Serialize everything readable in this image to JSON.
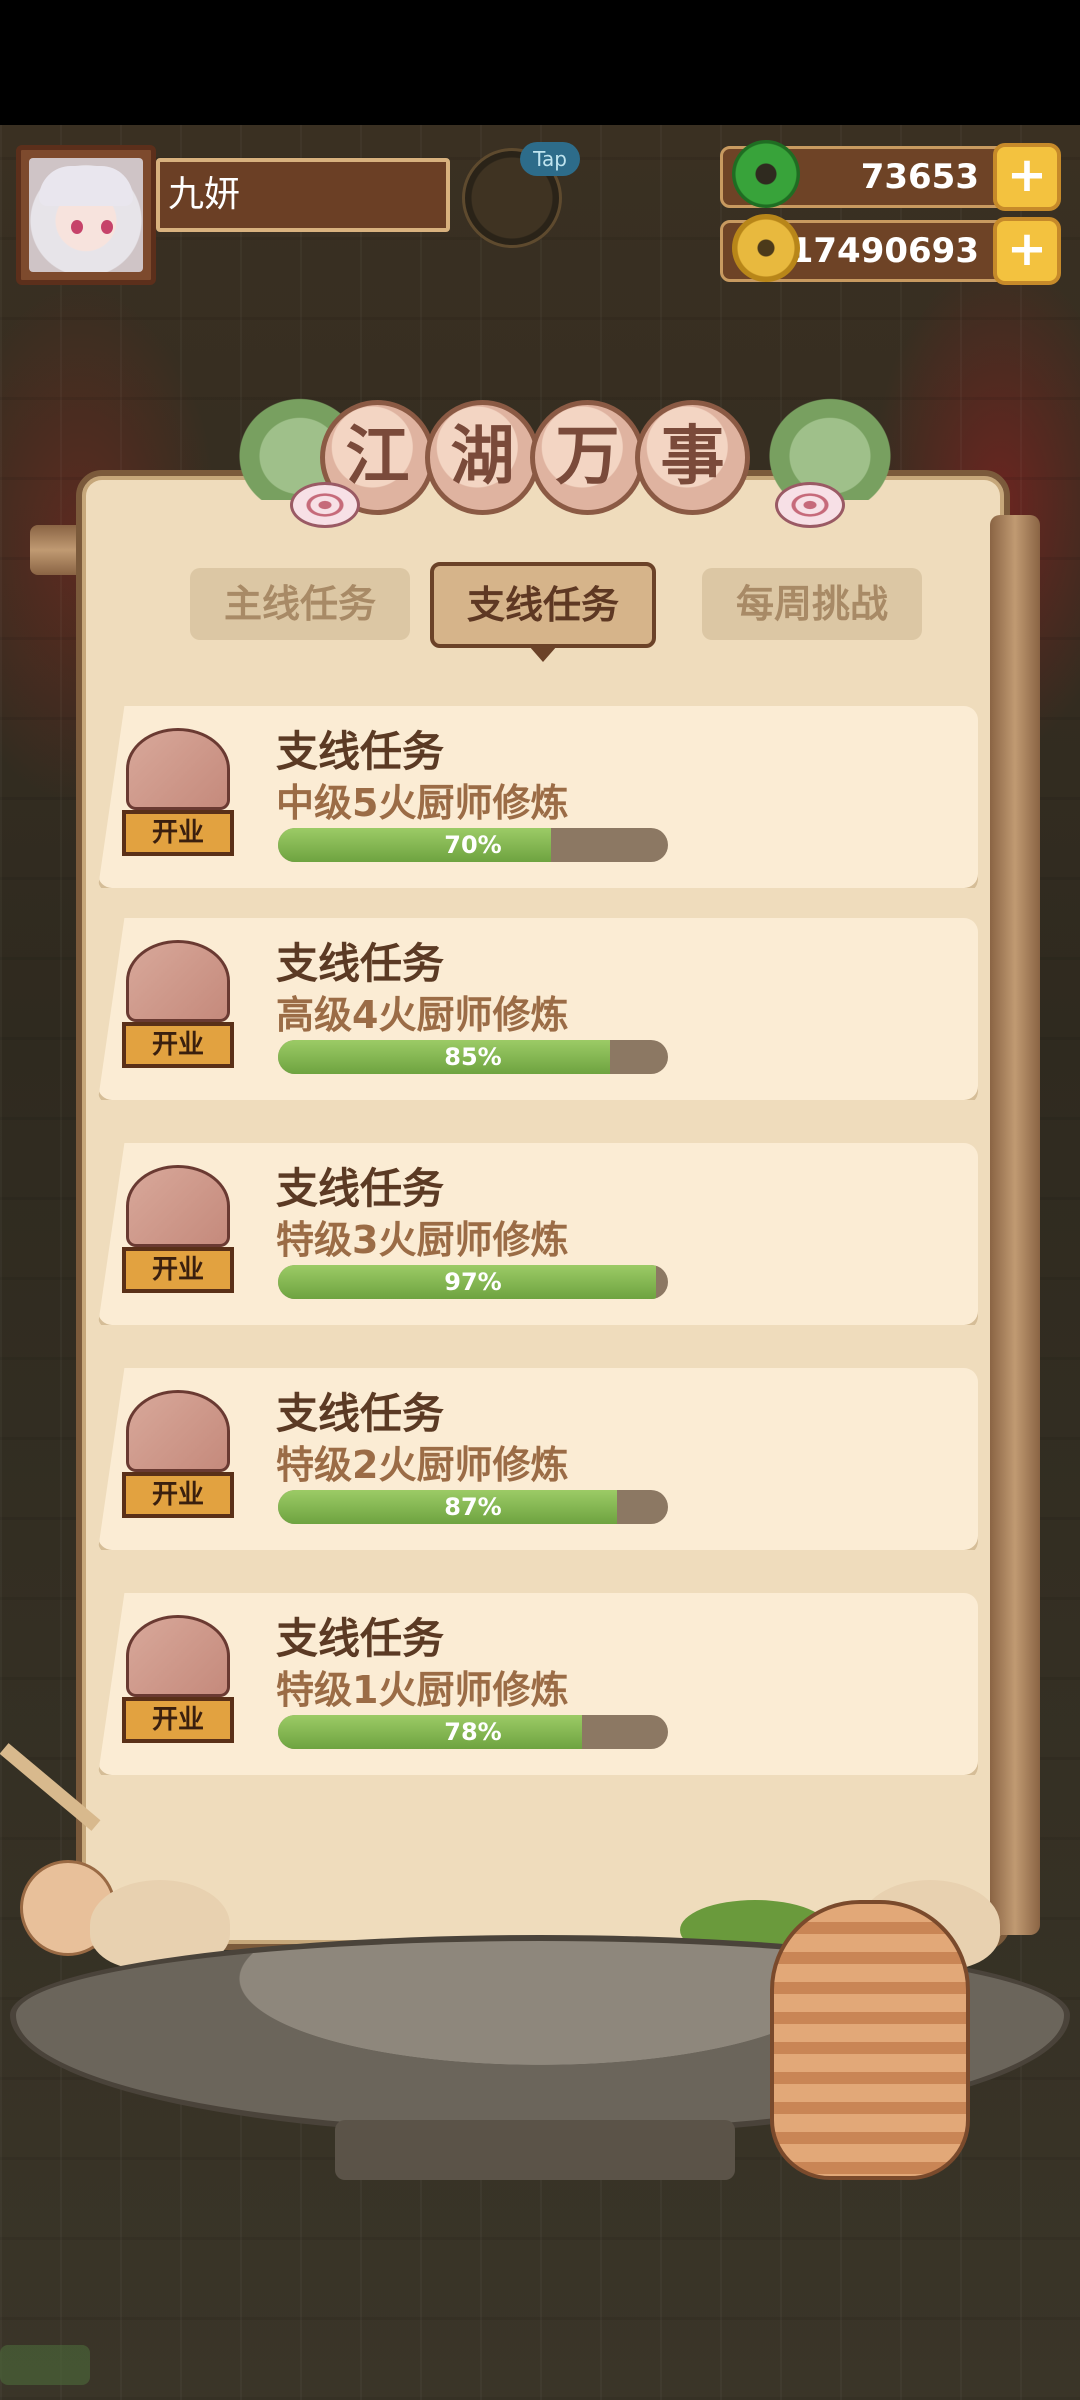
{
  "player": {
    "name": "九妍"
  },
  "tap_label": "Tap",
  "currencies": {
    "jade": {
      "icon": "jade-icon",
      "value": "73653"
    },
    "coin": {
      "icon": "coin-icon",
      "value": "17490693"
    },
    "plus_label": "+"
  },
  "panel": {
    "title_chars": [
      "江",
      "湖",
      "万",
      "事"
    ]
  },
  "tabs": [
    {
      "label": "主线任务",
      "active": false
    },
    {
      "label": "支线任务",
      "active": true
    },
    {
      "label": "每周挑战",
      "active": false
    }
  ],
  "tasks": [
    {
      "title": "支线任务",
      "subtitle": "中级5火厨师修炼",
      "progress": 70,
      "progress_label": "70%",
      "badge": "开业"
    },
    {
      "title": "支线任务",
      "subtitle": "高级4火厨师修炼",
      "progress": 85,
      "progress_label": "85%",
      "badge": "开业"
    },
    {
      "title": "支线任务",
      "subtitle": "特级3火厨师修炼",
      "progress": 97,
      "progress_label": "97%",
      "badge": "开业"
    },
    {
      "title": "支线任务",
      "subtitle": "特级2火厨师修炼",
      "progress": 87,
      "progress_label": "87%",
      "badge": "开业"
    },
    {
      "title": "支线任务",
      "subtitle": "特级1火厨师修炼",
      "progress": 78,
      "progress_label": "78%",
      "badge": "开业"
    }
  ],
  "colors": {
    "panel_bg": "#efdcbc",
    "card_bg": "#fbecd4",
    "progress_fill": "#7fb04c",
    "progress_track": "#8c7863",
    "title_text": "#5b3a24"
  }
}
